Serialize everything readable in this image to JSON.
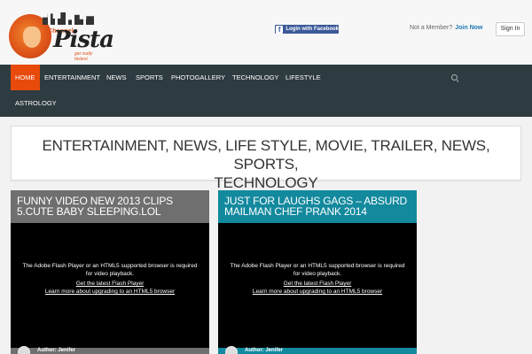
{
  "header": {
    "logo": {
      "brand_small": "Channel",
      "brand": "Pista",
      "tagline": "get really fastest"
    },
    "facebook_login_label": "Login with Facebook",
    "member_text": "Not a Member?",
    "join_label": "Join Now",
    "signin_label": "Sign In"
  },
  "nav": {
    "items": [
      {
        "label": "HOME",
        "active": true
      },
      {
        "label": "ENTERTAINMENT"
      },
      {
        "label": "NEWS"
      },
      {
        "label": "SPORTS"
      },
      {
        "label": "PHOTOGALLERY"
      },
      {
        "label": "TECHNOLOGY"
      },
      {
        "label": "LIFESTYLE"
      },
      {
        "label": "ASTROLOGY"
      }
    ],
    "search_icon": "search-icon"
  },
  "banner": {
    "line1": "ENTERTAINMENT, NEWS, LIFE STYLE, MOVIE, TRAILER, NEWS, SPORTS,",
    "line2": "TECHNOLOGY"
  },
  "posts": [
    {
      "title": "FUNNY VIDEO NEW 2013 CLIPS 5.CUTE BABY SLEEPING.LOL",
      "color": "#6f6f6f",
      "video": {
        "message_line1": "The Adobe Flash Player or an HTML5 supported browser is required",
        "message_line2": "for video playback.",
        "link1": "Get the latest Flash Player",
        "link2": "Learn more about upgrading to an HTML5 browser"
      },
      "author": "Author: Jenifer"
    },
    {
      "title": "JUST FOR LAUGHS GAGS – ABSURD MAILMAN CHEF PRANK 2014",
      "color": "#13899e",
      "video": {
        "message_line1": "The Adobe Flash Player or an HTML5 supported browser is required",
        "message_line2": "for video playback.",
        "link1": "Get the latest Flash Player",
        "link2": "Learn more about upgrading to an HTML5 browser"
      },
      "author": "Author: Jenifer"
    }
  ]
}
